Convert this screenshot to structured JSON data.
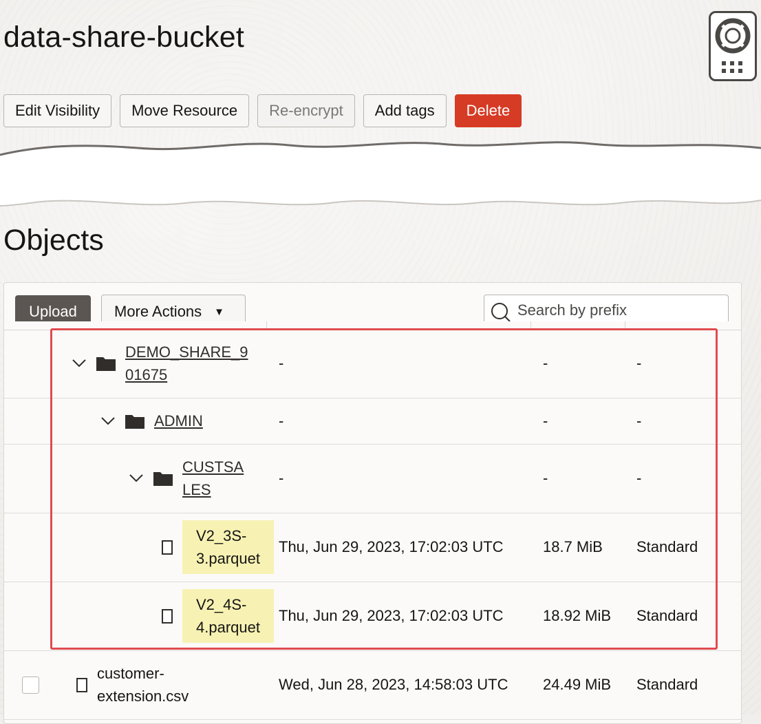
{
  "header": {
    "bucket_name": "data-share-bucket",
    "actions": {
      "edit_visibility": "Edit Visibility",
      "move_resource": "Move Resource",
      "re_encrypt": "Re-encrypt",
      "add_tags": "Add tags",
      "delete": "Delete"
    }
  },
  "objects": {
    "title": "Objects",
    "toolbar": {
      "upload": "Upload",
      "more_actions": "More Actions",
      "search_placeholder": "Search by prefix"
    },
    "rows": [
      {
        "type": "folder",
        "name_line1": "DEMO_SHARE_9",
        "name_line2": "01675",
        "modified": "-",
        "size": "-",
        "tier": "-"
      },
      {
        "type": "folder",
        "name_line1": "ADMIN",
        "name_line2": "",
        "modified": "-",
        "size": "-",
        "tier": "-"
      },
      {
        "type": "folder",
        "name_line1": "CUSTSA",
        "name_line2": "LES",
        "modified": "-",
        "size": "-",
        "tier": "-"
      },
      {
        "type": "file",
        "name_line1": "V2_3S-",
        "name_line2": "3.parquet",
        "modified": "Thu, Jun 29, 2023, 17:02:03 UTC",
        "size": "18.7 MiB",
        "tier": "Standard"
      },
      {
        "type": "file",
        "name_line1": "V2_4S-",
        "name_line2": "4.parquet",
        "modified": "Thu, Jun 29, 2023, 17:02:03 UTC",
        "size": "18.92 MiB",
        "tier": "Standard"
      },
      {
        "type": "file",
        "name_line1": "customer-",
        "name_line2": "extension.csv",
        "modified": "Wed, Jun 28, 2023, 14:58:03 UTC",
        "size": "24.49 MiB",
        "tier": "Standard"
      }
    ]
  },
  "colors": {
    "delete_button": "#d63b25",
    "upload_button": "#5b5652",
    "highlight": "#f7f2b3",
    "annotation_box": "#e04b4f"
  },
  "icons": [
    "help-lifebuoy-icon",
    "apps-grid-icon",
    "chevron-down-icon",
    "folder-icon",
    "file-icon",
    "search-icon"
  ]
}
